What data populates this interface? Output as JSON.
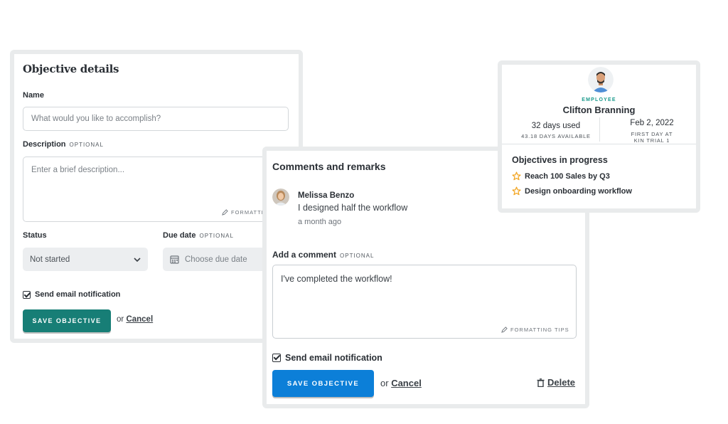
{
  "objective_card": {
    "title": "Objective details",
    "name_label": "Name",
    "name_placeholder": "What would you like to accomplish?",
    "description_label": "Description",
    "optional_tag": "OPTIONAL",
    "description_placeholder": "Enter a brief description...",
    "formatting_tips": "FORMATTIN",
    "status_label": "Status",
    "status_value": "Not started",
    "due_date_label": "Due date",
    "due_date_placeholder": "Choose due date",
    "notification_label": "Send email notification",
    "save_label": "SAVE OBJECTIVE",
    "or_text": "or",
    "cancel_label": "Cancel",
    "accent_color": "#177e76"
  },
  "comments_card": {
    "title": "Comments and remarks",
    "comment": {
      "author": "Melissa Benzo",
      "text": "I designed half the workflow",
      "time": "a month ago"
    },
    "add_comment_label": "Add a comment",
    "optional_tag": "OPTIONAL",
    "comment_value": "I've completed the workflow!",
    "formatting_tips": "FORMATTING TIPS",
    "notification_label": "Send email notification",
    "save_label": "SAVE OBJECTIVE",
    "or_text": "or",
    "cancel_label": "Cancel",
    "delete_label": "Delete",
    "accent_color": "#0c7fd8"
  },
  "employee_card": {
    "role": "EMPLOYEE",
    "name": "Clifton Branning",
    "days_used": "32 days used",
    "days_available": "43.18 DAYS AVAILABLE",
    "first_day_date": "Feb 2, 2022",
    "first_day_label_1": "FIRST DAY AT",
    "first_day_label_2": "KIN TRIAL 1",
    "objectives_title": "Objectives in progress",
    "objectives": [
      "Reach 100 Sales by Q3",
      "Design onboarding workflow"
    ],
    "star_color": "#f2a21b"
  }
}
